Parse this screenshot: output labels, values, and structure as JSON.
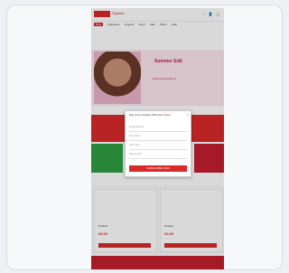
{
  "header": {
    "logo_text": "Spinner",
    "icons": "♡ 👤 🛒"
  },
  "nav": {
    "items": [
      "Bras",
      "Nightwear",
      "Lingerie",
      "Swim",
      "Sale",
      "Offers",
      "Help"
    ]
  },
  "banner": {
    "title": "Summer Edit",
    "subtitle": "Find your perfect fit"
  },
  "modal": {
    "title": "Sign up for exclusive offers and",
    "title_link": "updates",
    "fields": [
      "Email address",
      "First name",
      "Last name",
      "Date of birth"
    ],
    "button": "SUBSCRIBE NOW",
    "close": "×"
  },
  "products": [
    {
      "name": "Product",
      "price": "£0.00",
      "button": "ADD"
    },
    {
      "name": "Product",
      "price": "£0.00",
      "button": "ADD"
    }
  ],
  "colors": {
    "accent": "#d92a2a"
  }
}
